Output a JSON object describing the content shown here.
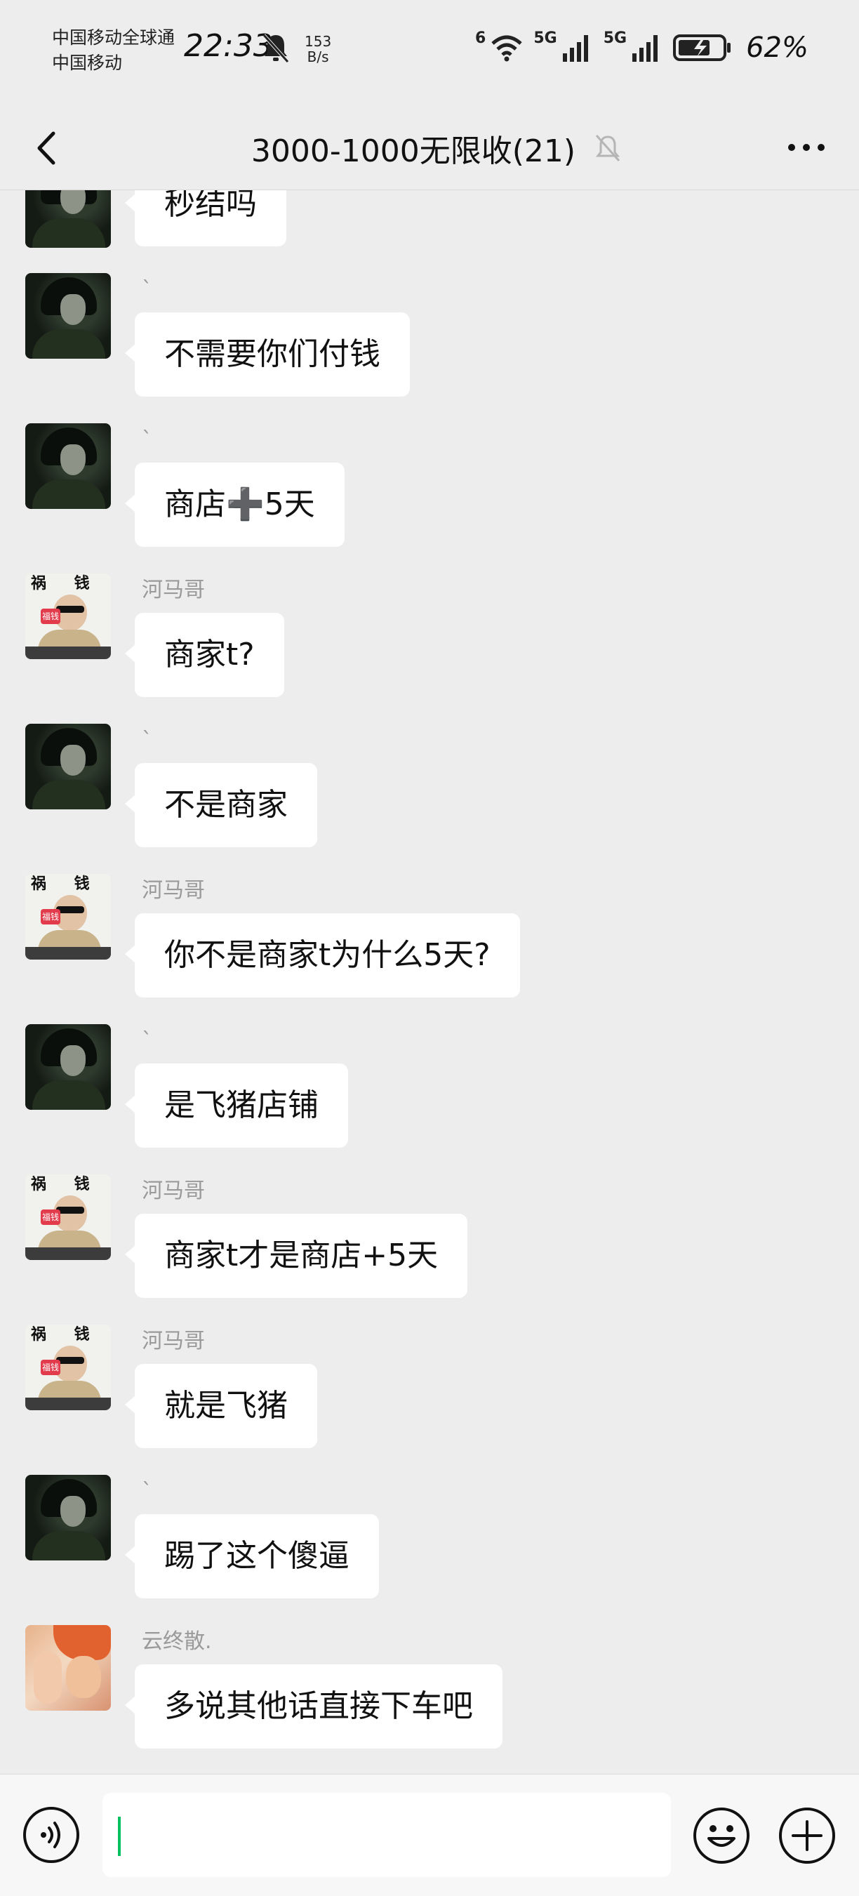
{
  "status_bar": {
    "carrier_line1": "中国移动全球通",
    "carrier_line2": "中国移动",
    "time": "22:33",
    "net_speed_value": "153",
    "net_speed_unit": "B/s",
    "wifi_label": "6",
    "sim1_label": "5G",
    "sim2_label": "5G",
    "battery_percent": "62%",
    "icons": [
      "mute-bell-icon",
      "wifi-icon",
      "signal-icon",
      "signal-icon",
      "battery-icon"
    ]
  },
  "nav": {
    "title": "3000-1000无限收(21)",
    "back_icon": "chevron-left-icon",
    "muted_icon": "bell-muted-icon",
    "more_icon": "more-dots-icon"
  },
  "messages": [
    {
      "sender": "",
      "text": "秒结吗",
      "avatar": "dark-portrait"
    },
    {
      "sender": "`",
      "text": "不需要你们付钱",
      "avatar": "dark-portrait"
    },
    {
      "sender": "`",
      "text": "商店➕5天",
      "avatar": "dark-portrait"
    },
    {
      "sender": "河马哥",
      "text": "商家t?",
      "avatar": "meme-baby"
    },
    {
      "sender": "`",
      "text": "不是商家",
      "avatar": "dark-portrait"
    },
    {
      "sender": "河马哥",
      "text": "你不是商家t为什么5天?",
      "avatar": "meme-baby"
    },
    {
      "sender": "`",
      "text": "是飞猪店铺",
      "avatar": "dark-portrait"
    },
    {
      "sender": "河马哥",
      "text": "商家t才是商店+5天",
      "avatar": "meme-baby"
    },
    {
      "sender": "河马哥",
      "text": "就是飞猪",
      "avatar": "meme-baby"
    },
    {
      "sender": "`",
      "text": "踢了这个傻逼",
      "avatar": "dark-portrait"
    },
    {
      "sender": "云终散.",
      "text": "多说其他话直接下车吧",
      "avatar": "photo-orange-hair"
    }
  ],
  "input_bar": {
    "value": "",
    "voice_icon": "voice-icon",
    "emoji_icon": "emoji-icon",
    "plus_icon": "plus-icon"
  },
  "colors": {
    "background": "#ededed",
    "bubble": "#ffffff",
    "sender_name": "#9a9a9a",
    "cursor": "#07c160"
  }
}
